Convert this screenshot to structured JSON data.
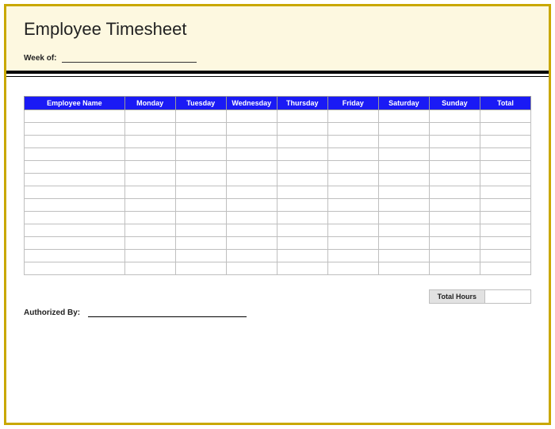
{
  "title": "Employee Timesheet",
  "week_label": "Week of:",
  "columns": [
    "Employee Name",
    "Monday",
    "Tuesday",
    "Wednesday",
    "Thursday",
    "Friday",
    "Saturday",
    "Sunday",
    "Total"
  ],
  "row_count": 13,
  "total_hours_label": "Total Hours",
  "authorized_label": "Authorized By:"
}
